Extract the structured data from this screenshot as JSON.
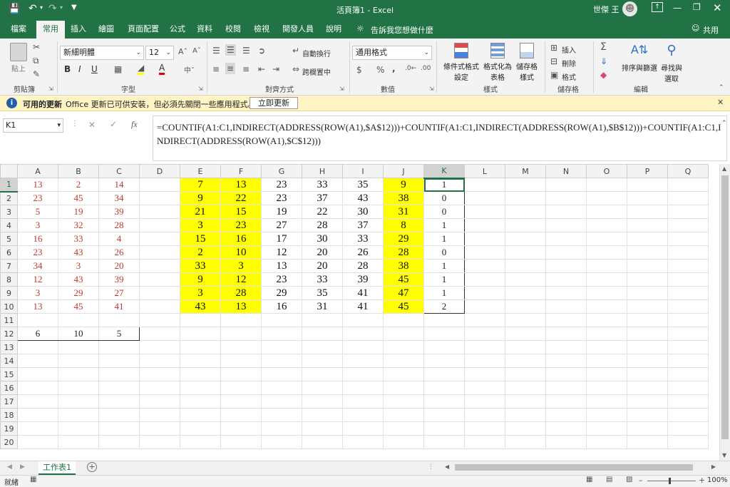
{
  "titlebar": {
    "doc_title": "活頁簿1  -  Excel",
    "user": "世傑 王",
    "save_icon": "save-icon",
    "undo_icon": "undo-icon",
    "redo_icon": "redo-icon"
  },
  "tabs": [
    {
      "label": "檔案"
    },
    {
      "label": "常用"
    },
    {
      "label": "插入"
    },
    {
      "label": "繪圖"
    },
    {
      "label": "頁面配置"
    },
    {
      "label": "公式"
    },
    {
      "label": "資料"
    },
    {
      "label": "校閱"
    },
    {
      "label": "檢視"
    },
    {
      "label": "開發人員"
    },
    {
      "label": "說明"
    }
  ],
  "tell_me": "告訴我您想做什麼",
  "share": "共用",
  "ribbon": {
    "paste": "貼上",
    "font_name": "新細明體",
    "font_size": "12",
    "wrap_text": "自動換行",
    "merge_center": "跨欄置中",
    "number_format": "通用格式",
    "currency": "$",
    "percent": "%",
    "comma": ",",
    "cond_format": "條件式格式",
    "cond_format2": "設定",
    "format_table": "格式化為",
    "format_table2": "表格",
    "cell_styles": "儲存格",
    "cell_styles2": "樣式",
    "insert": "插入",
    "delete": "刪除",
    "format": "格式",
    "sum": "Σ",
    "sort_filter": "排序與篩選",
    "find_select": "尋找與",
    "find_select2": "選取",
    "groups": {
      "clipboard": "剪貼簿",
      "font": "字型",
      "alignment": "對齊方式",
      "number": "數值",
      "styles": "樣式",
      "cells": "儲存格",
      "editing": "編輯"
    }
  },
  "message_bar": {
    "title": "可用的更新",
    "text": "Office 更新已可供安裝，但必須先關閉一些應用程式。",
    "button": "立即更新"
  },
  "formula_bar": {
    "name_box": "K1",
    "fx": "fx",
    "formula": "=COUNTIF(A1:C1,INDIRECT(ADDRESS(ROW(A1),$A$12)))+COUNTIF(A1:C1,INDIRECT(ADDRESS(ROW(A1),$B$12)))+COUNTIF(A1:C1,INDIRECT(ADDRESS(ROW(A1),$C$12)))"
  },
  "grid": {
    "columns": [
      "A",
      "B",
      "C",
      "D",
      "E",
      "F",
      "G",
      "H",
      "I",
      "J",
      "K",
      "L",
      "M",
      "N",
      "O",
      "P",
      "Q"
    ],
    "rows": [
      [
        "13",
        "2",
        "14",
        "",
        "7",
        "13",
        "23",
        "33",
        "35",
        "9",
        "1"
      ],
      [
        "23",
        "45",
        "34",
        "",
        "9",
        "22",
        "23",
        "37",
        "43",
        "38",
        "0"
      ],
      [
        "5",
        "19",
        "39",
        "",
        "21",
        "15",
        "19",
        "22",
        "30",
        "31",
        "0"
      ],
      [
        "3",
        "32",
        "28",
        "",
        "3",
        "23",
        "27",
        "28",
        "37",
        "8",
        "1"
      ],
      [
        "16",
        "33",
        "4",
        "",
        "15",
        "16",
        "17",
        "30",
        "33",
        "29",
        "1"
      ],
      [
        "23",
        "43",
        "26",
        "",
        "2",
        "10",
        "12",
        "20",
        "26",
        "28",
        "0"
      ],
      [
        "34",
        "3",
        "20",
        "",
        "33",
        "3",
        "13",
        "20",
        "28",
        "38",
        "1"
      ],
      [
        "12",
        "43",
        "39",
        "",
        "9",
        "12",
        "23",
        "33",
        "39",
        "45",
        "1"
      ],
      [
        "3",
        "29",
        "27",
        "",
        "3",
        "28",
        "29",
        "35",
        "41",
        "47",
        "1"
      ],
      [
        "13",
        "45",
        "41",
        "",
        "43",
        "13",
        "16",
        "31",
        "41",
        "45",
        "2"
      ],
      [
        "",
        "",
        "",
        "",
        "",
        "",
        "",
        "",
        "",
        "",
        ""
      ],
      [
        "6",
        "10",
        "5",
        "",
        "",
        "",
        "",
        "",
        "",
        "",
        ""
      ]
    ],
    "row_numbers": [
      "1",
      "2",
      "3",
      "4",
      "5",
      "6",
      "7",
      "8",
      "9",
      "10",
      "11",
      "12",
      "13",
      "14",
      "15",
      "16",
      "17",
      "18",
      "19",
      "20"
    ],
    "highlight_color": "#ffff00",
    "red_color": "#c0392b"
  },
  "sheet_tab": "工作表1",
  "status": {
    "ready": "就緒",
    "zoom": "100%"
  },
  "colors": {
    "accent": "#217346",
    "message_bg": "#fff4c3"
  }
}
